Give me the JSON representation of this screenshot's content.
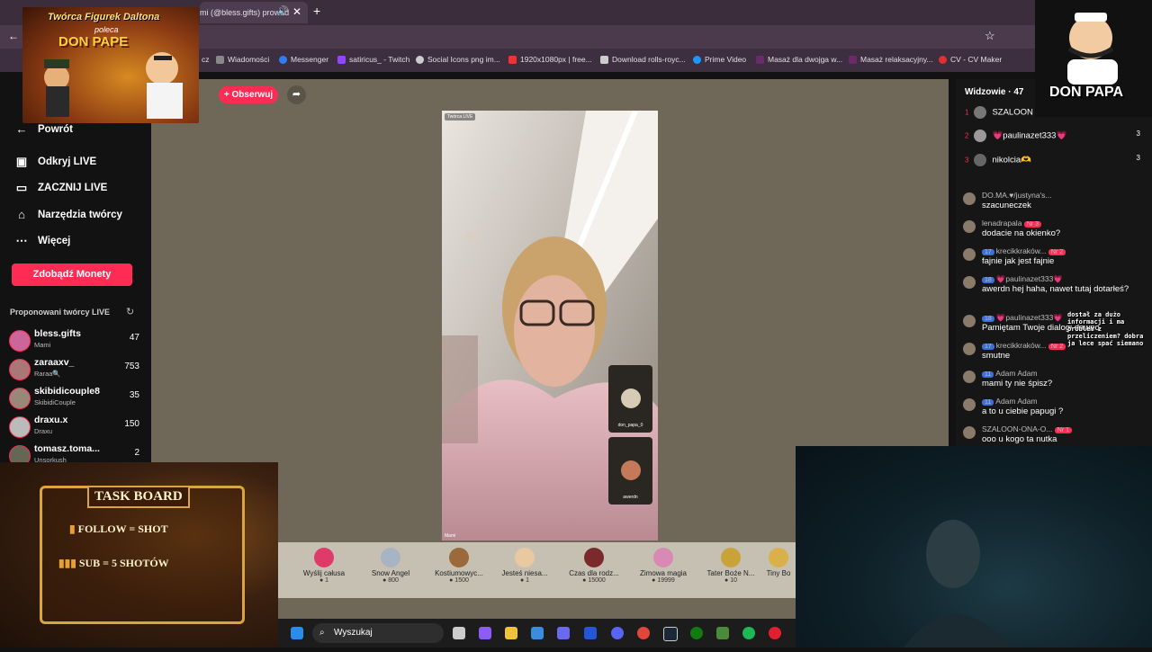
{
  "browser": {
    "tab_title": "mi (@bless.gifts) prowad",
    "bookmarks": [
      "cz",
      "Wiadomości",
      "Messenger",
      "satiricus_ - Twitch",
      "Social Icons png im...",
      "1920x1080px | free...",
      "Download rolls-royc...",
      "Prime Video",
      "Masaż dla dwojga w...",
      "Masaż relaksacyjny...",
      "CV - CV Maker"
    ]
  },
  "promo": {
    "line1": "Twórca Figurek Daltona",
    "line2": "poleca",
    "brand": "DON PAPE"
  },
  "logo": {
    "name": "DON PAPA"
  },
  "sidebar": {
    "back": "Powrót",
    "items": [
      "Odkryj LIVE",
      "ZACZNIJ LIVE",
      "Narzędzia twórcy",
      "Więcej"
    ],
    "coins_button": "Zdobądź Monety",
    "recommended_title": "Proponowani twórcy LIVE",
    "creators": [
      {
        "name": "bless.gifts",
        "sub": "Mami",
        "count": "47"
      },
      {
        "name": "zaraaxv_",
        "sub": "Raraa🔍",
        "count": "753"
      },
      {
        "name": "skibidicouple8",
        "sub": "SkibidiCouple",
        "count": "35"
      },
      {
        "name": "draxu.x",
        "sub": "Draxu",
        "count": "150"
      },
      {
        "name": "tomasz.toma...",
        "sub": "Unsorkush",
        "count": "2"
      }
    ]
  },
  "stream": {
    "follow_button": "+ Obserwuj",
    "video_tag": "Twórca LIVE",
    "host_label": "Mami",
    "guests": [
      "don_papa_0",
      "awerdn"
    ]
  },
  "gifts": [
    {
      "name": "Wyślij całusa",
      "price": "1"
    },
    {
      "name": "Snow Angel",
      "price": "800"
    },
    {
      "name": "Kostiumowyc...",
      "price": "1500"
    },
    {
      "name": "Jesteś niesa...",
      "price": "1"
    },
    {
      "name": "Czas dla rodz...",
      "price": "15000"
    },
    {
      "name": "Zimowa magia",
      "price": "19999"
    },
    {
      "name": "Tater Boże N...",
      "price": "10"
    },
    {
      "name": "Tiny Bo",
      "price": ""
    }
  ],
  "chat": {
    "viewers_label": "Widzowie · 47",
    "top": [
      {
        "rank": "1",
        "name": "SZALOON",
        "score": ""
      },
      {
        "rank": "2",
        "name": "💗paulinazet333💗",
        "score": "3"
      },
      {
        "rank": "3",
        "name": "nikolcia🫶",
        "score": "3"
      }
    ],
    "messages": [
      {
        "user": "DO.MA.♥/justyna's...",
        "text": "szacuneczek"
      },
      {
        "user": "lenadrapala",
        "badge": "Nr 3",
        "text": "dodacie na okienko?"
      },
      {
        "user": "krecikkraków...",
        "level": "17",
        "badge": "Nr 2",
        "text": "fajnie jak jest fajnie"
      },
      {
        "user": "💗paulinazet333💗",
        "level": "18",
        "text": "awerdn hej haha, nawet tutaj dotarłeś?"
      },
      {
        "user": "💗paulinazet333💗",
        "level": "18",
        "text": "Pamiętam Twoje dialogi dawno"
      },
      {
        "user": "krecikkraków...",
        "level": "17",
        "badge": "Nr 2",
        "text": "smutne"
      },
      {
        "user": "Adam Adam",
        "level": "11",
        "text": "mami ty nie śpisz?"
      },
      {
        "user": "Adam Adam",
        "level": "11",
        "text": "a to u ciebie papugi ?"
      },
      {
        "user": "SZALOON-ONA-O...",
        "badge": "Nr 1",
        "text": "ooo u kogo ta nutka"
      }
    ],
    "overlay_text": "dostał za dużo informacji i ma problem z przeliczeniem? dobra ja lece spać siemano"
  },
  "taskboard": {
    "title": "TASK BOARD",
    "rows": [
      "FOLLOW = SHOT",
      "SUB = 5 SHOTÓW"
    ]
  },
  "taskbar": {
    "search": "Wyszukaj"
  }
}
